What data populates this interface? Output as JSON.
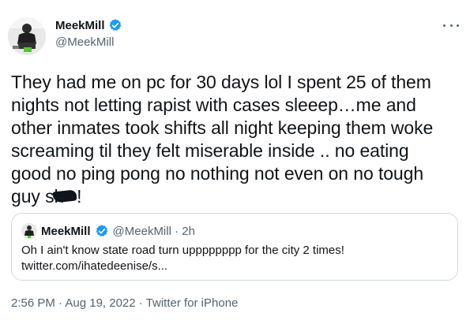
{
  "author": {
    "display_name": "MeekMill",
    "handle": "@MeekMill"
  },
  "tweet": {
    "line1": "They had me on pc for 30 days lol  I spent 25 of them",
    "line2": "nights not letting rapist with cases sleeep…me and",
    "line3": "other inmates took shifts all night keeping them woke",
    "line4": "screaming til they felt miserable inside .. no eating",
    "line5": "good  no ping pong no nothing not even on no tough",
    "line6_start": "guy sh",
    "line6_end": "!"
  },
  "quoted_tweet": {
    "display_name": "MeekMill",
    "handle_time": "@MeekMill · 2h",
    "text_line1": "Oh I ain't know state road turn upppppppp for the city 2 times!",
    "text_line2": "twitter.com/ihatedeenise/s..."
  },
  "meta": {
    "timestamp": "2:56 PM · Aug 19, 2022 · Twitter for iPhone"
  },
  "colors": {
    "verified": "#1d9bf0",
    "secondary_text": "#536471",
    "border": "#cfd9de"
  },
  "icons": [
    "verified-badge-icon",
    "more-options-icon"
  ]
}
